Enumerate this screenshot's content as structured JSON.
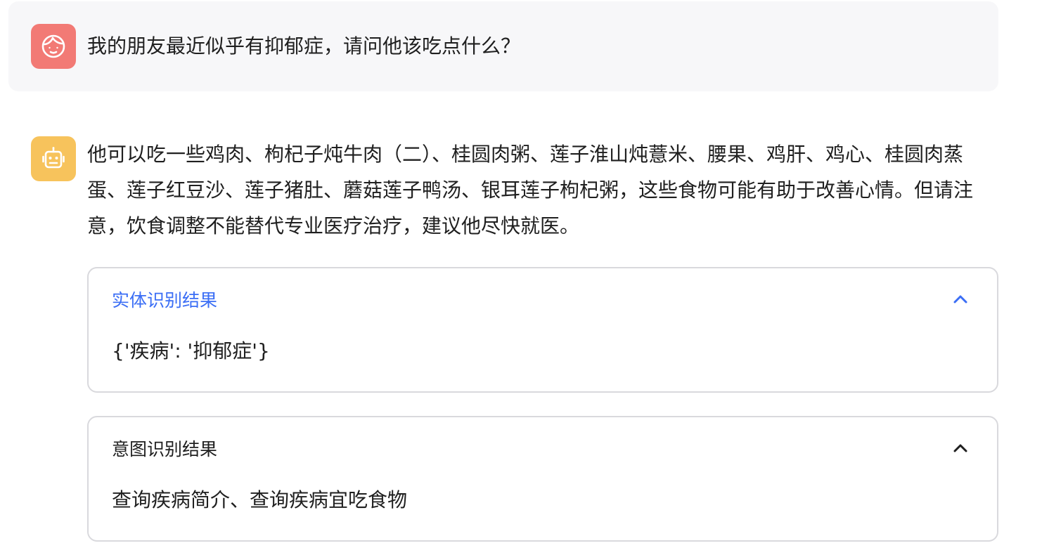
{
  "conversation": {
    "user_message": {
      "text": "我的朋友最近似乎有抑郁症，请问他该吃点什么？",
      "avatar_icon": "face-icon",
      "avatar_color": "#f27a75"
    },
    "bot_message": {
      "text": "他可以吃一些鸡肉、枸杞子炖牛肉（二）、桂圆肉粥、莲子淮山炖薏米、腰果、鸡肝、鸡心、桂圆肉蒸蛋、莲子红豆沙、莲子猪肚、蘑菇莲子鸭汤、银耳莲子枸杞粥，这些食物可能有助于改善心情。但请注意，饮食调整不能替代专业医疗治疗，建议他尽快就医。",
      "avatar_icon": "robot-icon",
      "avatar_color": "#f7c35c"
    }
  },
  "panels": {
    "entity": {
      "title": "实体识别结果",
      "content": "{'疾病': '抑郁症'}",
      "expanded": true,
      "title_color": "#3b6ef5",
      "toggle_icon": "chevron-up-icon"
    },
    "intent": {
      "title": "意图识别结果",
      "content": "查询疾病简介、查询疾病宜吃食物",
      "expanded": true,
      "toggle_icon": "chevron-up-icon"
    }
  }
}
